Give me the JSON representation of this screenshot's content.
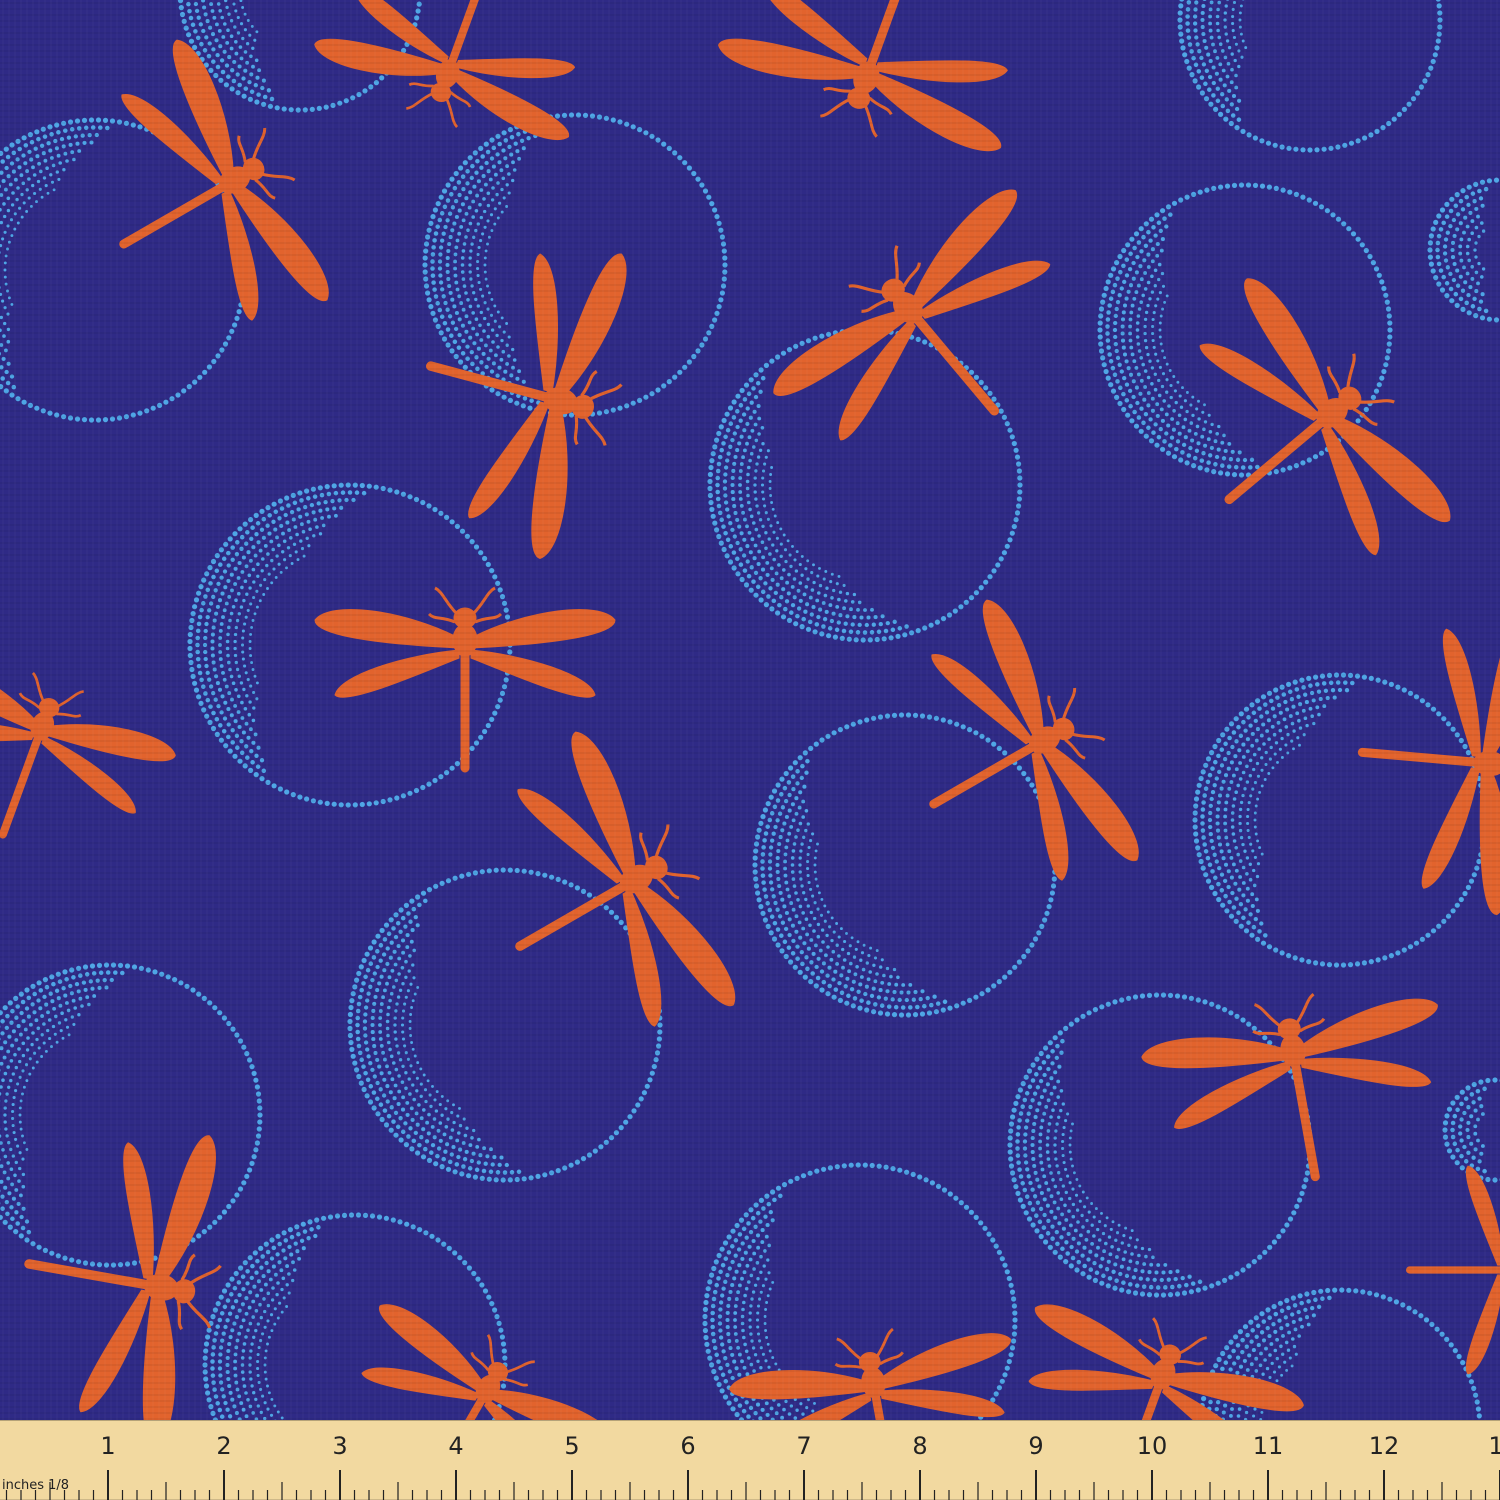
{
  "colors": {
    "background": "#2f2a86",
    "bubble_dots": "#4ea6e6",
    "dragonfly": "#e2632d",
    "ruler": "#f2d9a0",
    "ruler_ticks": "#222222"
  },
  "pattern": {
    "bubble_icon": "dotted-circle-icon",
    "insect_icon": "dragonfly-icon"
  },
  "ruler": {
    "unit_label": "inches 1/8",
    "numbers": [
      "1",
      "2",
      "3",
      "4",
      "5",
      "6",
      "7",
      "8",
      "9",
      "10",
      "11",
      "12",
      "1"
    ]
  }
}
